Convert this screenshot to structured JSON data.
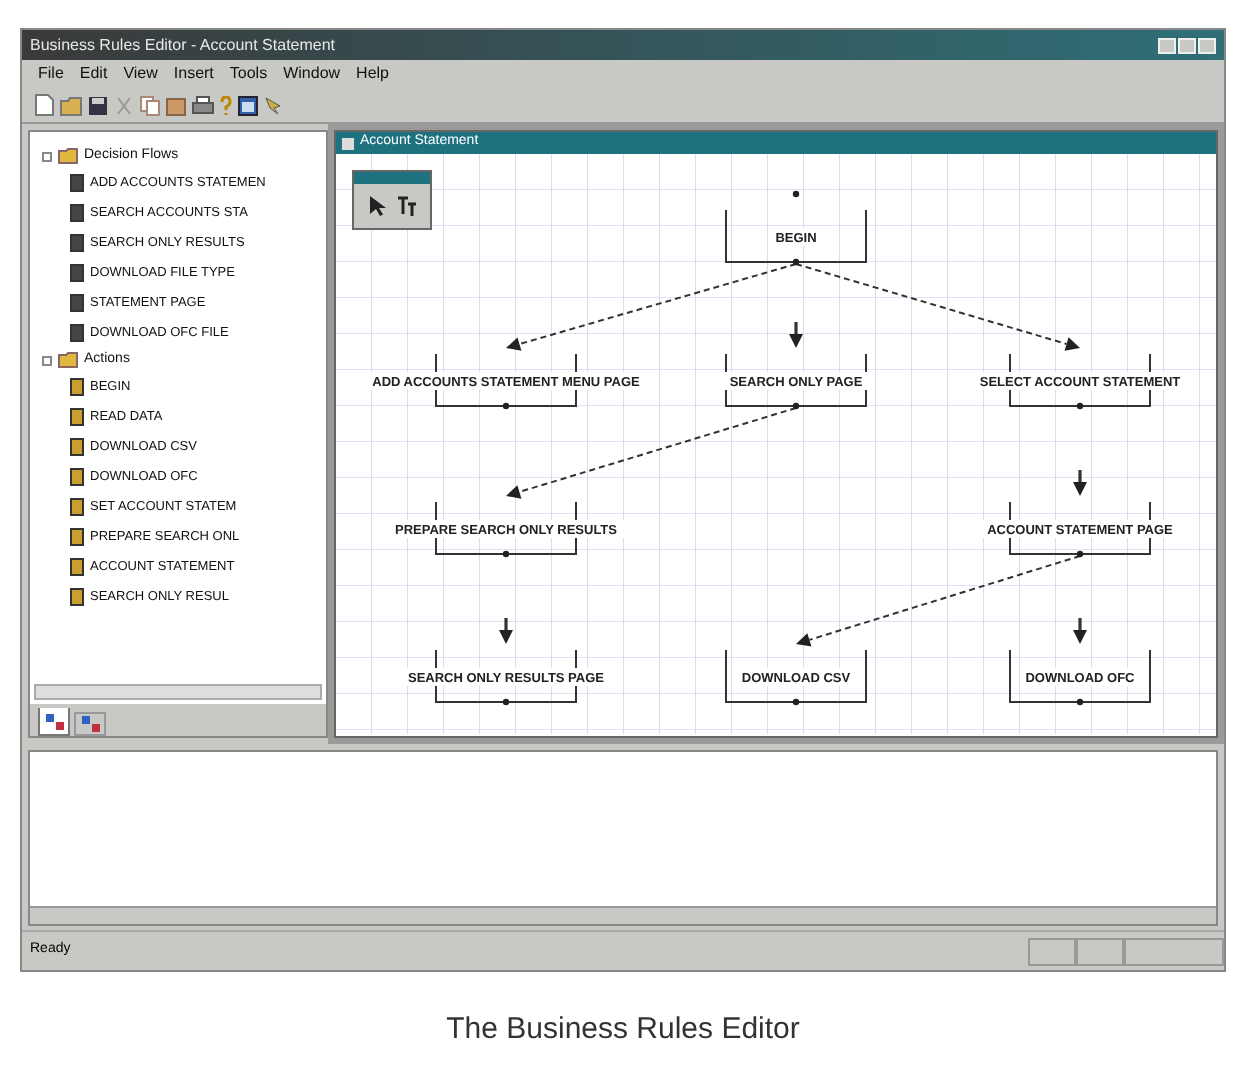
{
  "window": {
    "title": "Business Rules Editor - Account Statement"
  },
  "menu": [
    "File",
    "Edit",
    "View",
    "Insert",
    "Tools",
    "Window",
    "Help"
  ],
  "side_panel": {
    "tree": [
      {
        "label": "Decision Flows",
        "expanded": true,
        "children": [
          {
            "label": "ADD ACCOUNTS STATEMEN"
          },
          {
            "label": "SEARCH ACCOUNTS STA"
          },
          {
            "label": "SEARCH ONLY RESULTS"
          },
          {
            "label": "DOWNLOAD FILE TYPE"
          },
          {
            "label": "STATEMENT PAGE"
          },
          {
            "label": "DOWNLOAD OFC FILE"
          }
        ]
      },
      {
        "label": "Actions",
        "expanded": true,
        "children": [
          {
            "label": "BEGIN"
          },
          {
            "label": "READ DATA"
          },
          {
            "label": "DOWNLOAD CSV"
          },
          {
            "label": "DOWNLOAD OFC"
          },
          {
            "label": "SET ACCOUNT STATEM"
          },
          {
            "label": "PREPARE SEARCH ONL"
          },
          {
            "label": "ACCOUNT STATEMENT"
          },
          {
            "label": "SEARCH ONLY RESUL"
          }
        ]
      }
    ],
    "tabs": [
      {
        "selected": true
      },
      {
        "selected": false
      }
    ]
  },
  "document": {
    "title": "Account Statement",
    "flow": {
      "label": "BEGIN",
      "children": [
        {
          "label": "ADD ACCOUNTS STATEMENT MENU PAGE",
          "dashed": true
        },
        {
          "label": "SEARCH ONLY PAGE",
          "dashed": false,
          "children": [
            {
              "label": "PREPARE SEARCH ONLY RESULTS",
              "dashed": true,
              "children": [
                {
                  "label": "SEARCH ONLY RESULTS PAGE",
                  "dashed": false
                }
              ]
            }
          ]
        },
        {
          "label": "SELECT ACCOUNT STATEMENT",
          "dashed": true,
          "children": [
            {
              "label": "ACCOUNT STATEMENT PAGE",
              "dashed": false,
              "children": [
                {
                  "label": "DOWNLOAD CSV",
                  "dashed": true
                },
                {
                  "label": "DOWNLOAD OFC",
                  "dashed": false
                }
              ]
            }
          ]
        }
      ]
    }
  },
  "status_bar": {
    "text": "Ready"
  },
  "caption": "The Business Rules Editor"
}
